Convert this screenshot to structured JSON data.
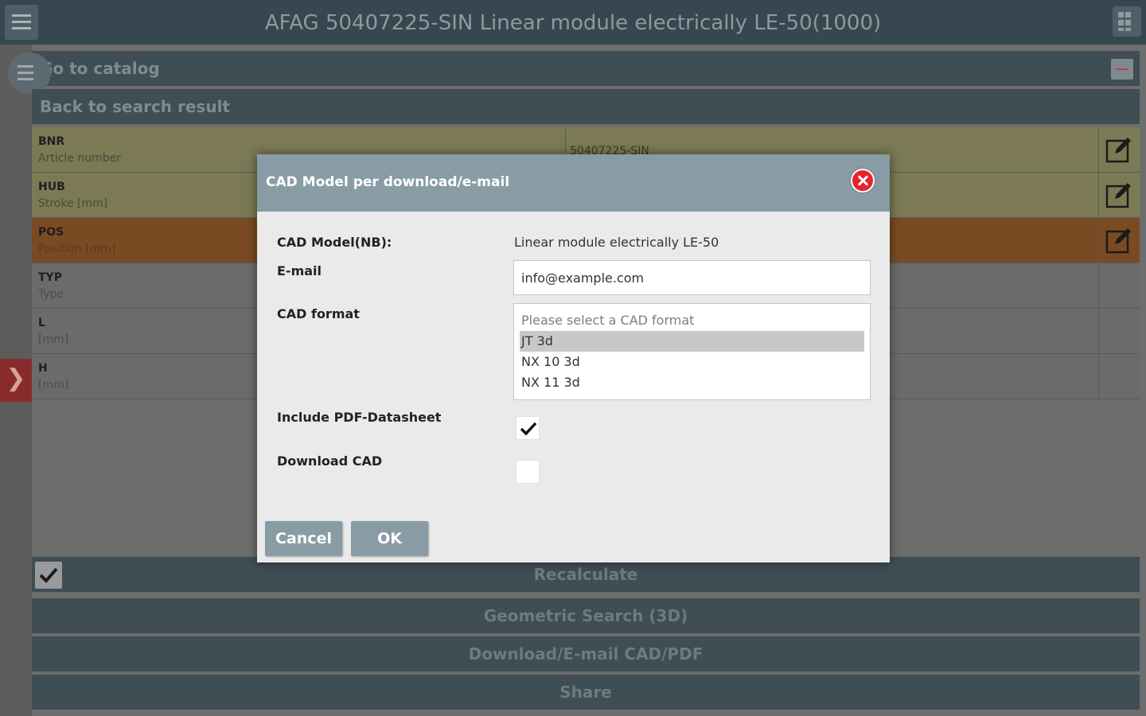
{
  "app": {
    "title": "AFAG 50407225-SIN Linear module electrically LE-50(1000)"
  },
  "nav": {
    "catalog_label": "Go to catalog",
    "back_label": "Back to search result"
  },
  "parameters": [
    {
      "code": "BNR",
      "desc": "Article number",
      "value": "50407225-SIN",
      "state": "yellow",
      "editable": true
    },
    {
      "code": "HUB",
      "desc": "Stroke [mm]",
      "value": "",
      "state": "yellow",
      "editable": true
    },
    {
      "code": "POS",
      "desc": "Position [mm]",
      "value": "",
      "state": "orange",
      "editable": true
    },
    {
      "code": "TYP",
      "desc": "Type",
      "value": "",
      "state": "gray",
      "editable": false
    },
    {
      "code": "L",
      "desc": "[mm]",
      "value": "",
      "state": "gray",
      "editable": false
    },
    {
      "code": "H",
      "desc": "[mm]",
      "value": "",
      "state": "gray",
      "editable": false
    }
  ],
  "actions": {
    "recalculate": "Recalculate",
    "geometric_search": "Geometric Search (3D)",
    "download": "Download/E-mail CAD/PDF",
    "share": "Share"
  },
  "dialog": {
    "title": "CAD Model per download/e-mail",
    "cad_model_label": "CAD Model(NB):",
    "cad_model_value": "Linear module electrically LE-50",
    "email_label": "E-mail",
    "email_value": "info@example.com",
    "cad_format_label": "CAD format",
    "cad_format_options": [
      "Please select a CAD format",
      "JT 3d",
      "NX 10 3d",
      "NX 11 3d"
    ],
    "cad_format_selected": "JT 3d",
    "include_pdf_label": "Include PDF-Datasheet",
    "include_pdf_checked": true,
    "download_cad_label": "Download CAD",
    "download_cad_checked": false,
    "cancel_label": "Cancel",
    "ok_label": "OK"
  },
  "colors": {
    "header": "#37474f",
    "dialog_header": "#899ca6",
    "close": "#e3262b",
    "row_yellow": "#7b7a55",
    "row_orange": "#7a4b22"
  }
}
